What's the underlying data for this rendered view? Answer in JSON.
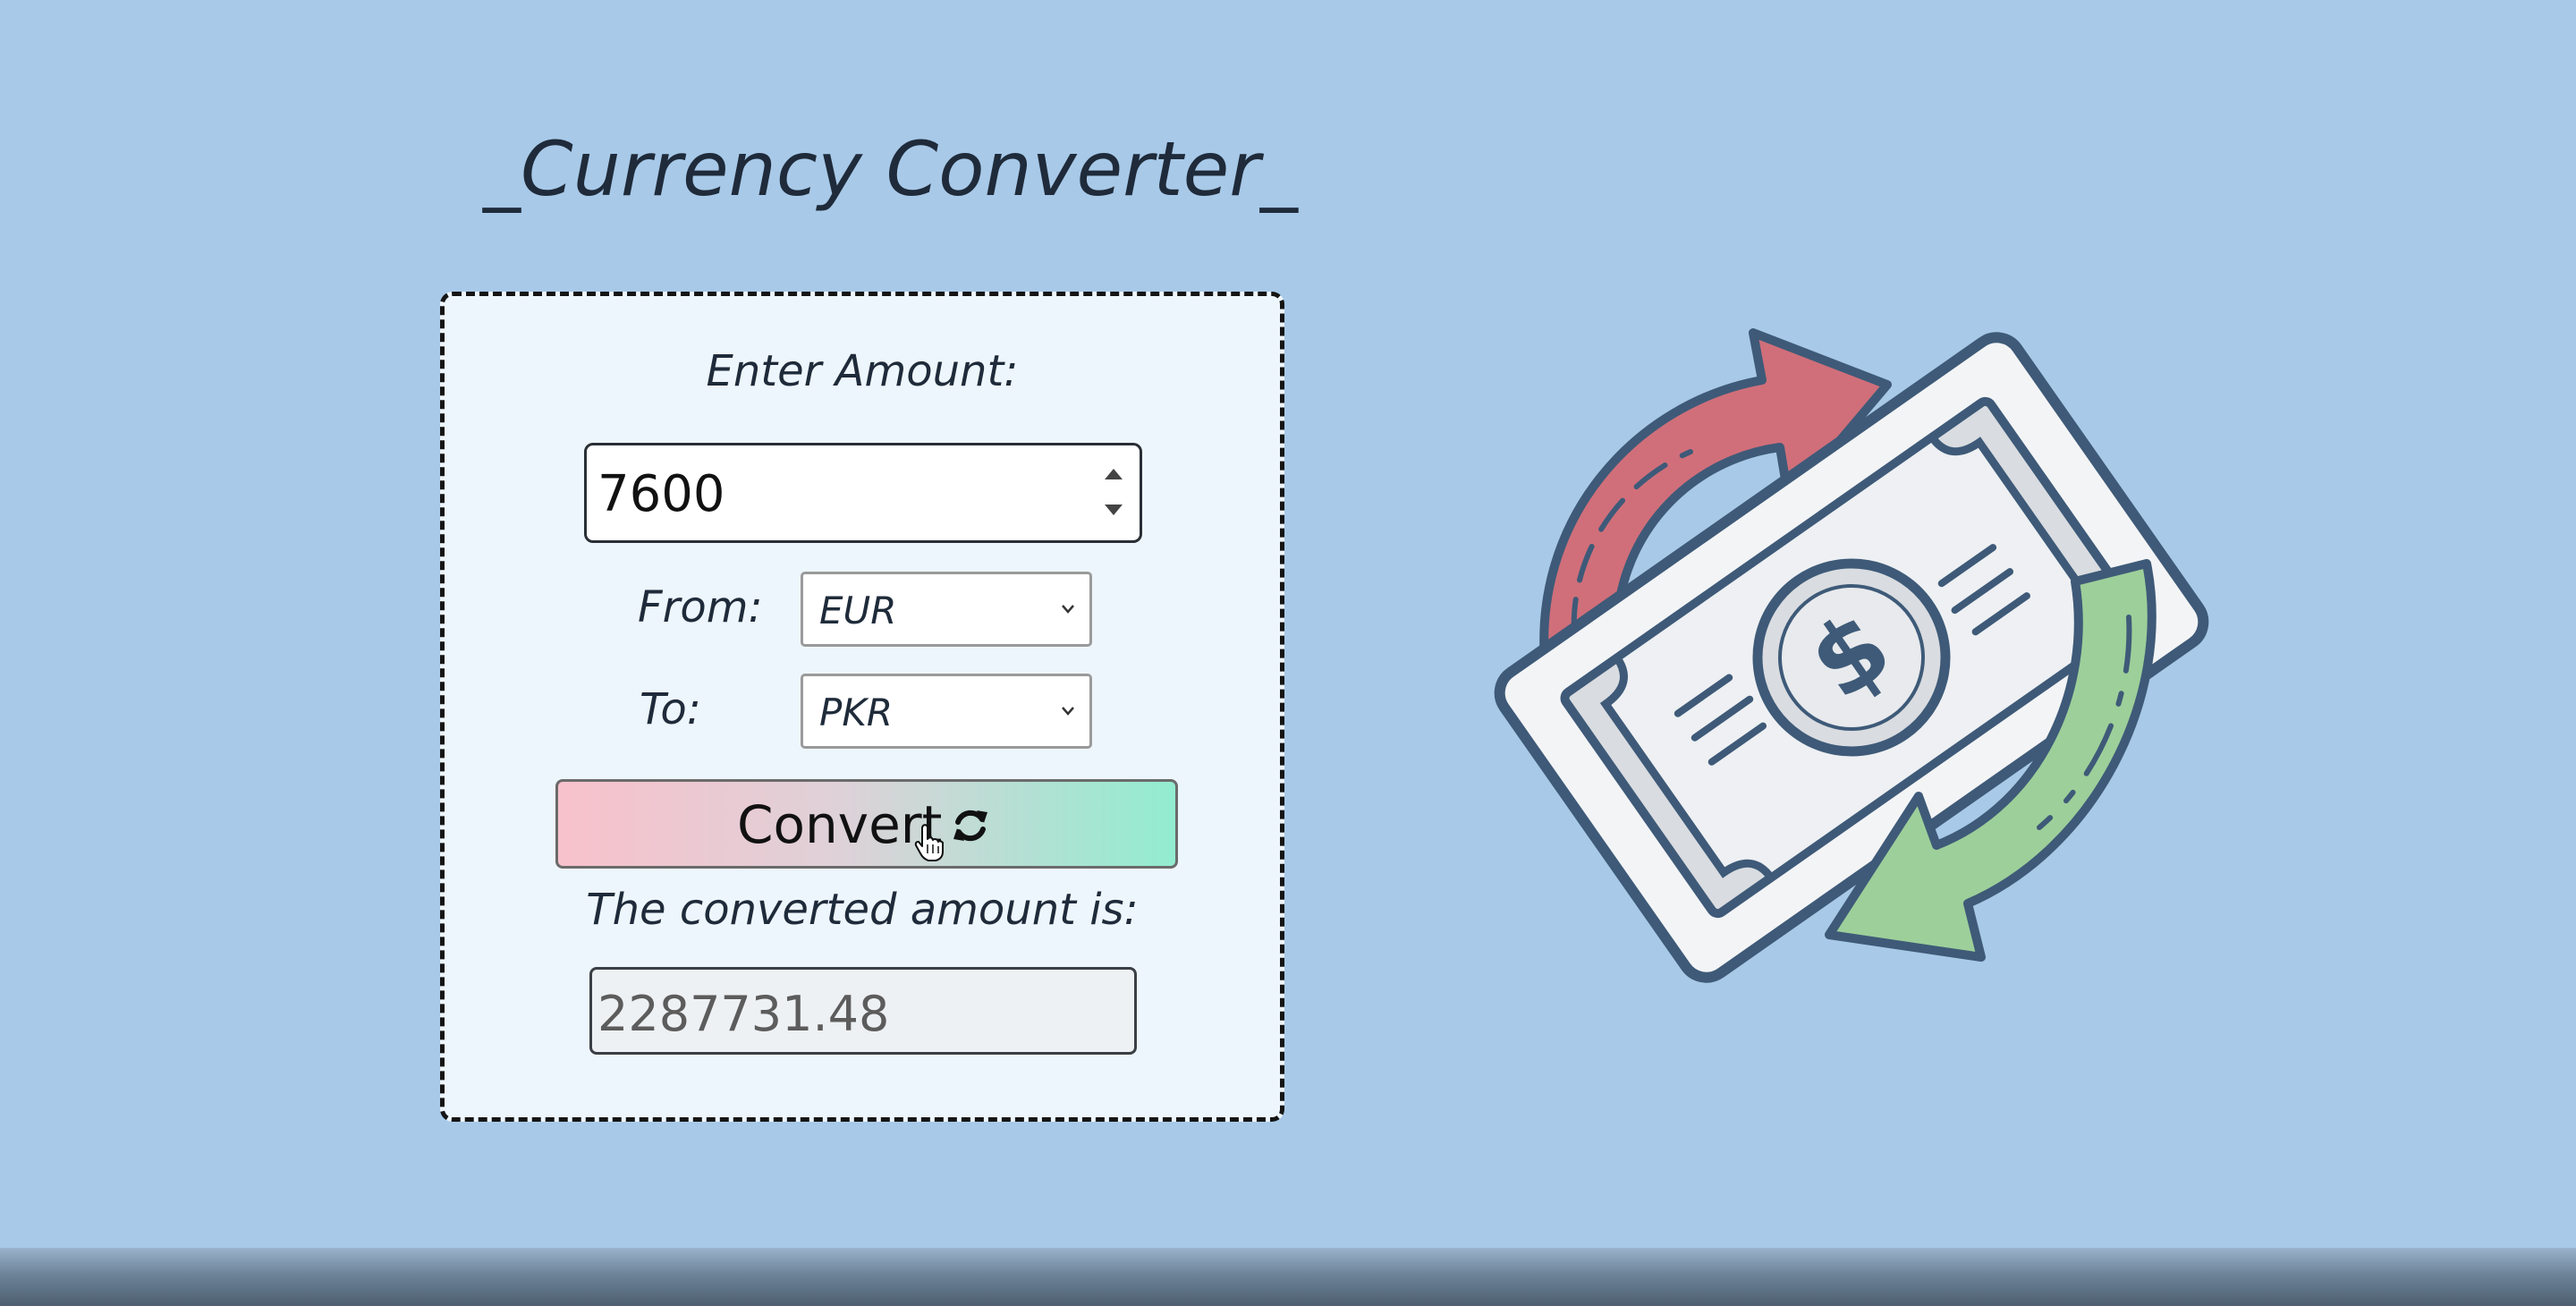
{
  "page": {
    "title": "_Currency Converter_"
  },
  "converter": {
    "amount_label": "Enter Amount:",
    "amount_value": "7600",
    "from_label": "From:",
    "from_value": "EUR",
    "to_label": "To:",
    "to_value": "PKR",
    "convert_label": "Convert",
    "result_label": "The converted amount is:",
    "result_value": "2287731.48"
  },
  "icons": {
    "convert_icon": "refresh-icon",
    "cursor": "hand-pointer-icon",
    "illustration": "money-exchange-icon"
  },
  "colors": {
    "background": "#a8c9e8",
    "card_background": "#eef6fd",
    "button_gradient_start": "#f8c1cb",
    "button_gradient_end": "#92ecd0",
    "arrow_red": "#d06f7a",
    "arrow_green": "#9dcf9a",
    "outline": "#3e5a78"
  }
}
